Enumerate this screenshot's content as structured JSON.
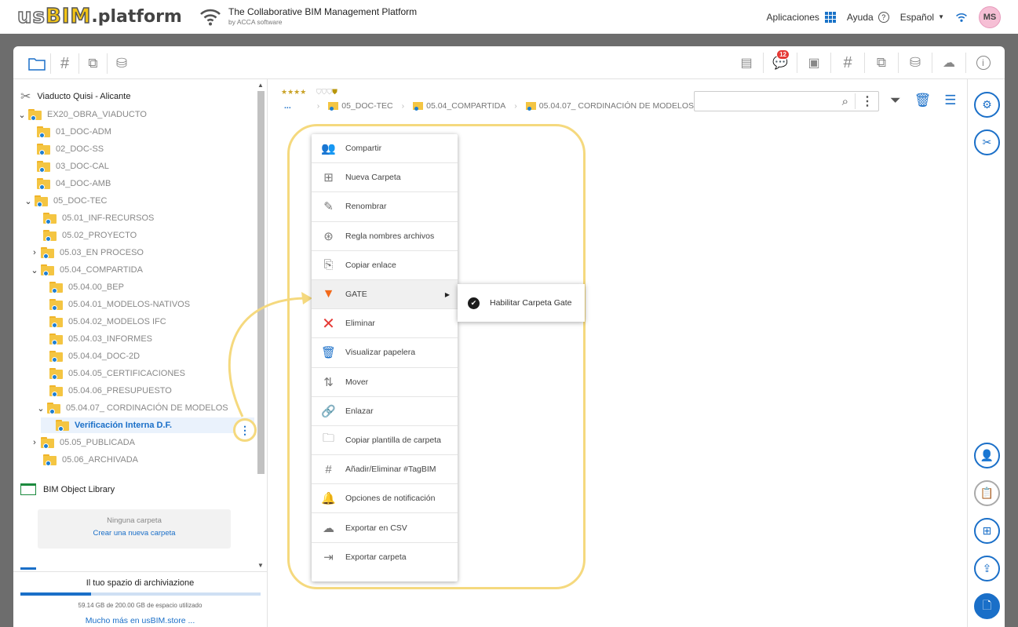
{
  "header": {
    "logo_us": "us",
    "logo_bim": "BIM",
    "logo_platform": ".platform",
    "tagline": "The Collaborative BIM Management Platform",
    "tagline_sub": "by ACCA software",
    "apps_label": "Aplicaciones",
    "help_label": "Ayuda",
    "language": "Español",
    "avatar_initials": "MS"
  },
  "toolbar": {
    "notification_count": "12"
  },
  "sidebar": {
    "project_name": "Viaducto Quisi - Alicante",
    "tree": {
      "root": "EX20_OBRA_VIADUCTO",
      "f01": "01_DOC-ADM",
      "f02": "02_DOC-SS",
      "f03": "03_DOC-CAL",
      "f04": "04_DOC-AMB",
      "f05": "05_DOC-TEC",
      "f0501": "05.01_INF-RECURSOS",
      "f0502": "05.02_PROYECTO",
      "f0503": "05.03_EN PROCESO",
      "f0504": "05.04_COMPARTIDA",
      "f050400": "05.04.00_BEP",
      "f050401": "05.04.01_MODELOS-NATIVOS",
      "f050402": "05.04.02_MODELOS IFC",
      "f050403": "05.04.03_INFORMES",
      "f050404": "05.04.04_DOC-2D",
      "f050405": "05.04.05_CERTIFICACIONES",
      "f050406": "05.04.06_PRESUPUESTO",
      "f050407": "05.04.07_ CORDINACIÓN DE MODELOS",
      "selected": "Verificación Interna D.F.",
      "f0505": "05.05_PUBLICADA",
      "f0506": "05.06_ARCHIVADA"
    },
    "object_library": "BIM Object Library",
    "empty_text": "Ninguna carpeta",
    "create_link": "Crear una nueva carpeta",
    "storage": {
      "title": "Il tuo spazio di archiviazione",
      "used_text": "59.14 GB de 200.00 GB de espacio utilizado",
      "used_fraction": 0.2957,
      "more_link": "Mucho más en usBIM.store ..."
    }
  },
  "content": {
    "breadcrumb": [
      "...",
      "05_DOC-TEC",
      "05.04_COMPARTIDA",
      "05.04.07_ CORDINACIÓN DE MODELOS"
    ],
    "search_placeholder": ""
  },
  "context_menu": {
    "items": [
      {
        "label": "Compartir",
        "icon": "share-user-icon"
      },
      {
        "label": "Nueva Carpeta",
        "icon": "new-folder-icon"
      },
      {
        "label": "Renombrar",
        "icon": "pencil-icon"
      },
      {
        "label": "Regla nombres archivos",
        "icon": "asterisk-rule-icon"
      },
      {
        "label": "Copiar enlace",
        "icon": "copy-link-icon"
      },
      {
        "label": "GATE",
        "icon": "gate-triangle-icon"
      },
      {
        "label": "Eliminar",
        "icon": "delete-x-icon"
      },
      {
        "label": "Visualizar papelera",
        "icon": "trash-icon"
      },
      {
        "label": "Mover",
        "icon": "move-arrows-icon"
      },
      {
        "label": "Enlazar",
        "icon": "link-icon"
      },
      {
        "label": "Copiar plantilla de carpeta",
        "icon": "folder-template-icon"
      },
      {
        "label": "Añadir/Eliminar #TagBIM",
        "icon": "tagbim-icon"
      },
      {
        "label": "Opciones de notificación",
        "icon": "bell-icon"
      },
      {
        "label": "Exportar en CSV",
        "icon": "cloud-export-icon"
      },
      {
        "label": "Exportar carpeta",
        "icon": "export-folder-icon"
      }
    ],
    "submenu_label": "Habilitar Carpeta Gate"
  },
  "colors": {
    "accent": "#1a6fc8",
    "highlight": "#f5d97e",
    "gate": "#f26a1b",
    "delete": "#e53935"
  }
}
